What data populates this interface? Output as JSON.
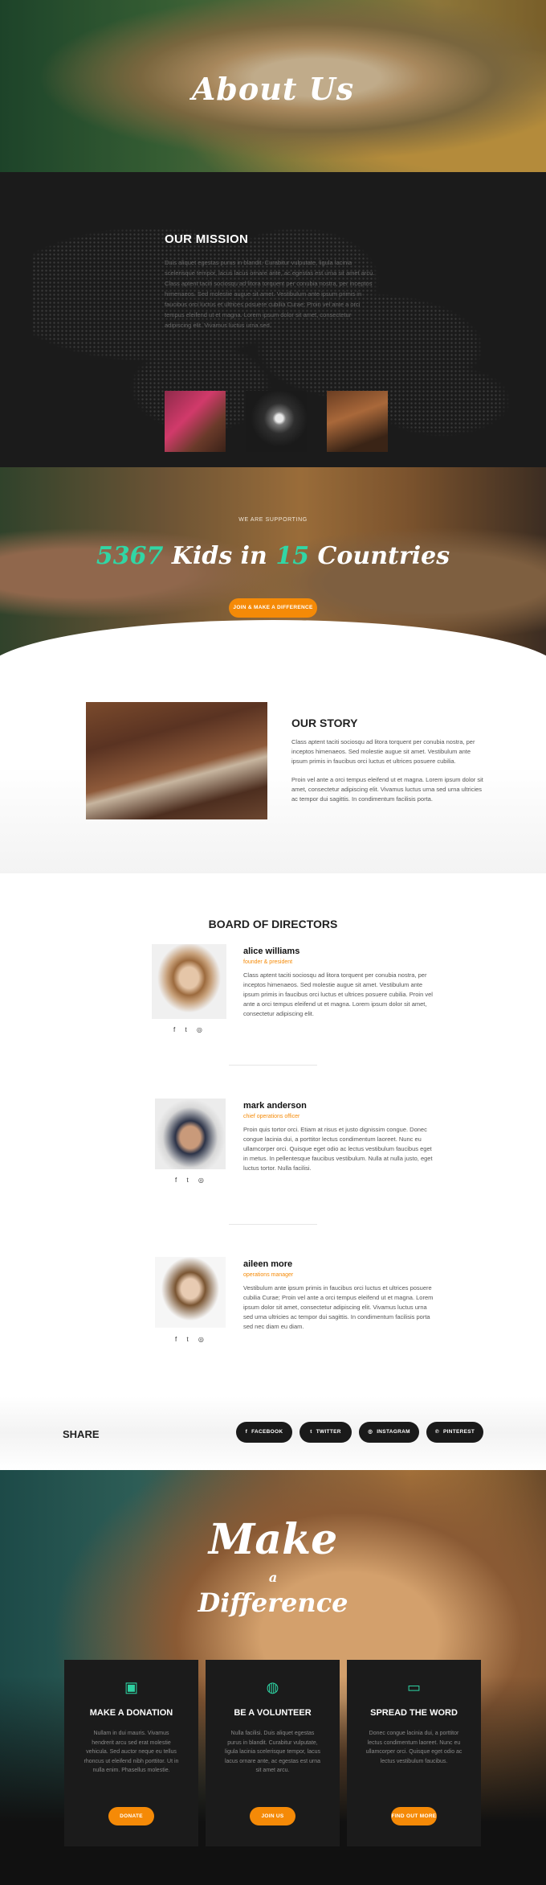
{
  "hero": {
    "title": "About Us"
  },
  "mission": {
    "heading": "OUR MISSION",
    "text": "Duis aliquet egestas purus in blandit. Curabitur vulputate, ligula lacinia scelerisque tempor, lacus lacus ornare ante, ac egestas est urna sit amet arcu. Class aptent taciti sociosqu ad litora torquent per conubia nostra, per inceptos himenaeos. Sed molestie augue sit amet. Vestibulum ante ipsum primis in faucibus orci luctus et ultrices posuere cubilia Curae; Proin vel ante a orci tempus eleifend ut et magna. Lorem ipsum dolor sit amet, consectetur adipiscing elit. Vivamus luctus urna sed."
  },
  "support": {
    "small": "WE ARE SUPPORTING",
    "kids_count": "5367",
    "kids_label": "Kids in",
    "countries_count": "15",
    "countries_label": "Countries",
    "button": "JOIN & MAKE A DIFFERENCE"
  },
  "story": {
    "heading": "OUR STORY",
    "p1": "Class aptent taciti sociosqu ad litora torquent per conubia nostra, per inceptos himenaeos. Sed molestie augue sit amet. Vestibulum ante ipsum primis in faucibus orci luctus et ultrices posuere cubilia.",
    "p2": "Proin vel ante a orci tempus eleifend ut et magna. Lorem ipsum dolor sit amet, consectetur adipiscing elit. Vivamus luctus urna sed urna ultricies ac tempor dui sagittis. In condimentum facilisis porta."
  },
  "board": {
    "heading": "BOARD OF DIRECTORS",
    "members": [
      {
        "name": "alice williams",
        "role": "founder & president",
        "bio": "Class aptent taciti sociosqu ad litora torquent per conubia nostra, per inceptos himenaeos. Sed molestie augue sit amet. Vestibulum ante ipsum primis in faucibus orci luctus et ultrices posuere cubilia. Proin vel ante a orci tempus eleifend ut et magna. Lorem ipsum dolor sit amet, consectetur adipiscing elit."
      },
      {
        "name": "mark anderson",
        "role": "chief operations officer",
        "bio": "Proin quis tortor orci. Etiam at risus et justo dignissim congue. Donec congue lacinia dui, a porttitor lectus condimentum laoreet. Nunc eu ullamcorper orci. Quisque eget odio ac lectus vestibulum faucibus eget in metus. In pellentesque faucibus vestibulum. Nulla at nulla justo, eget luctus tortor. Nulla facilisi."
      },
      {
        "name": "aileen more",
        "role": "operations manager",
        "bio": "Vestibulum ante ipsum primis in faucibus orci luctus et ultrices posuere cubilia Curae; Proin vel ante a orci tempus eleifend ut et magna. Lorem ipsum dolor sit amet, consectetur adipiscing elit. Vivamus luctus urna sed urna ultricies ac tempor dui sagittis. In condimentum facilisis porta sed nec diam eu diam."
      }
    ],
    "social_icons": "f  t  ◎"
  },
  "share": {
    "heading": "SHARE",
    "buttons": [
      {
        "icon": "f",
        "label": "FACEBOOK"
      },
      {
        "icon": "t",
        "label": "TWITTER"
      },
      {
        "icon": "◎",
        "label": "INSTAGRAM"
      },
      {
        "icon": "℗",
        "label": "PINTEREST"
      }
    ]
  },
  "difference": {
    "line1": "Make",
    "line2": "a",
    "line3": "Difference",
    "cards": [
      {
        "icon": "▣",
        "title": "MAKE A DONATION",
        "text": "Nullam in dui mauris. Vivamus hendrerit arcu sed erat molestie vehicula. Sed auctor neque eu tellus rhoncus ut eleifend nibh porttitor. Ut in nulla enim. Phasellus molestie.",
        "button": "DONATE"
      },
      {
        "icon": "◍",
        "title": "BE A VOLUNTEER",
        "text": "Nulla facilisi. Duis aliquet egestas purus in blandit. Curabitur vulputate, ligula lacinia scelerisque tempor, lacus lacus ornare ante, ac egestas est urna sit amet arcu.",
        "button": "JOIN US"
      },
      {
        "icon": "▭",
        "title": "SPREAD THE WORD",
        "text": "Donec congue lacinia dui, a porttitor lectus condimentum laoreet. Nunc eu ullamcorper orci. Quisque eget odio ac lectus vestibulum faucibus.",
        "button": "FIND OUT MORE"
      }
    ]
  },
  "colors": {
    "accent": "#f58a07",
    "teal": "#31d6a5",
    "dark": "#1b1b1b"
  }
}
